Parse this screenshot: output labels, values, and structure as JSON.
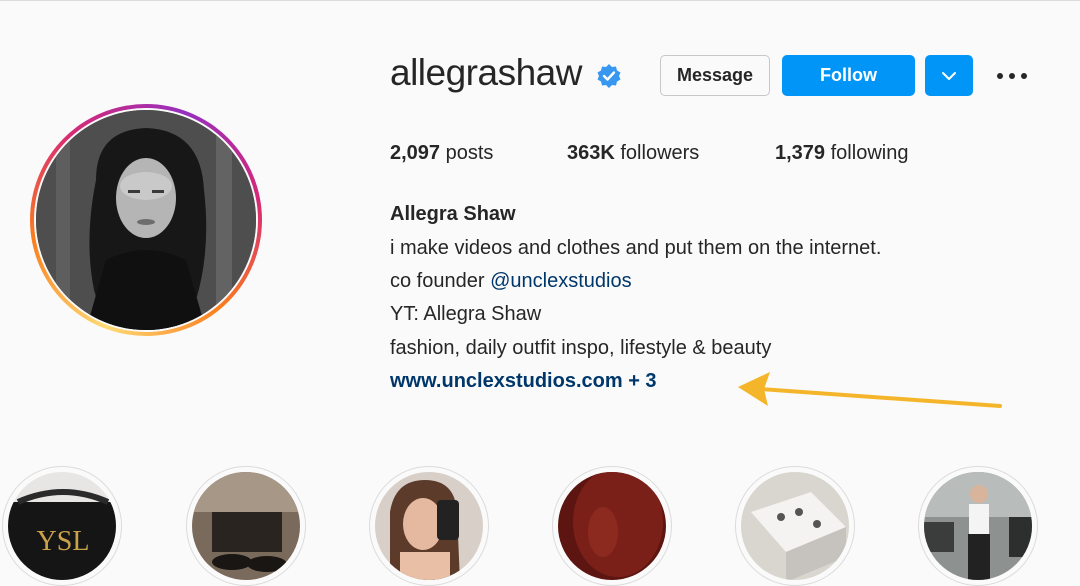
{
  "profile": {
    "username": "allegrashaw",
    "verified_icon": "verified-badge-icon",
    "avatar_icon": "profile-photo"
  },
  "actions": {
    "message_label": "Message",
    "follow_label": "Follow",
    "dropdown_icon": "chevron-down-icon",
    "more_icon": "more-options-icon"
  },
  "stats": {
    "posts_count": "2,097",
    "posts_label": "posts",
    "followers_count": "363K",
    "followers_label": "followers",
    "following_count": "1,379",
    "following_label": "following"
  },
  "bio": {
    "name": "Allegra Shaw",
    "line1": "i make videos and clothes and put them on the internet.",
    "line2_prefix": "co founder",
    "line2_mention": "@unclexstudios",
    "line3": "YT: Allegra Shaw",
    "line4": "fashion, daily outfit inspo, lifestyle & beauty",
    "link": "www.unclexstudios.com + 3"
  },
  "annotation": {
    "arrow_color": "#f5b52a"
  },
  "colors": {
    "accent": "#0095f6",
    "link": "#00376b",
    "verified": "#3897f0"
  },
  "highlights": [
    {
      "icon": "highlight-bag"
    },
    {
      "icon": "highlight-shoes"
    },
    {
      "icon": "highlight-selfie"
    },
    {
      "icon": "highlight-red"
    },
    {
      "icon": "highlight-box"
    },
    {
      "icon": "highlight-street"
    }
  ]
}
